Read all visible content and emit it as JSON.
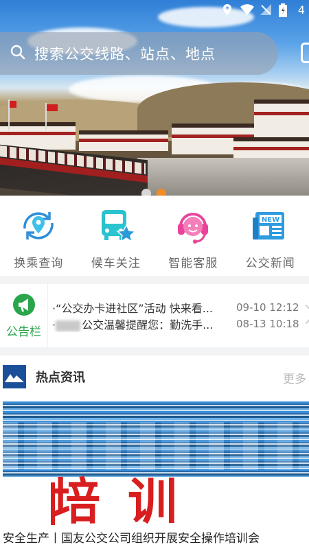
{
  "status_bar": {
    "battery_text": "4"
  },
  "search": {
    "placeholder": "搜索公交线路、站点、地点"
  },
  "banner": {
    "active_dot_index": 1,
    "dot_count": 2
  },
  "quick_menu": [
    {
      "label": "换乘查询",
      "icon": "transfer-query-icon",
      "color": "#2e8fd8"
    },
    {
      "label": "候车关注",
      "icon": "bus-star-icon",
      "color": "#27b7c6"
    },
    {
      "label": "智能客服",
      "icon": "customer-service-icon",
      "color": "#e8459a"
    },
    {
      "label": "公交新闻",
      "icon": "newspaper-icon",
      "color": "#2e9be0"
    }
  ],
  "notice": {
    "label": "公告栏",
    "items": [
      {
        "title": "·“公交办卡进社区”活动 快来看...",
        "time": "09-10 12:12"
      },
      {
        "title": "公交温馨提醒您：勤洗手...",
        "time": "08-13 10:18"
      }
    ]
  },
  "hot_news": {
    "title": "热点资讯",
    "more": "更多",
    "image_text": "培训",
    "caption": "安全生产丨国友公交公司组织开展安全操作培训会"
  },
  "colors": {
    "accent_orange": "#f28c24",
    "notice_green": "#2aa54b",
    "news_red": "#d81e1e"
  }
}
